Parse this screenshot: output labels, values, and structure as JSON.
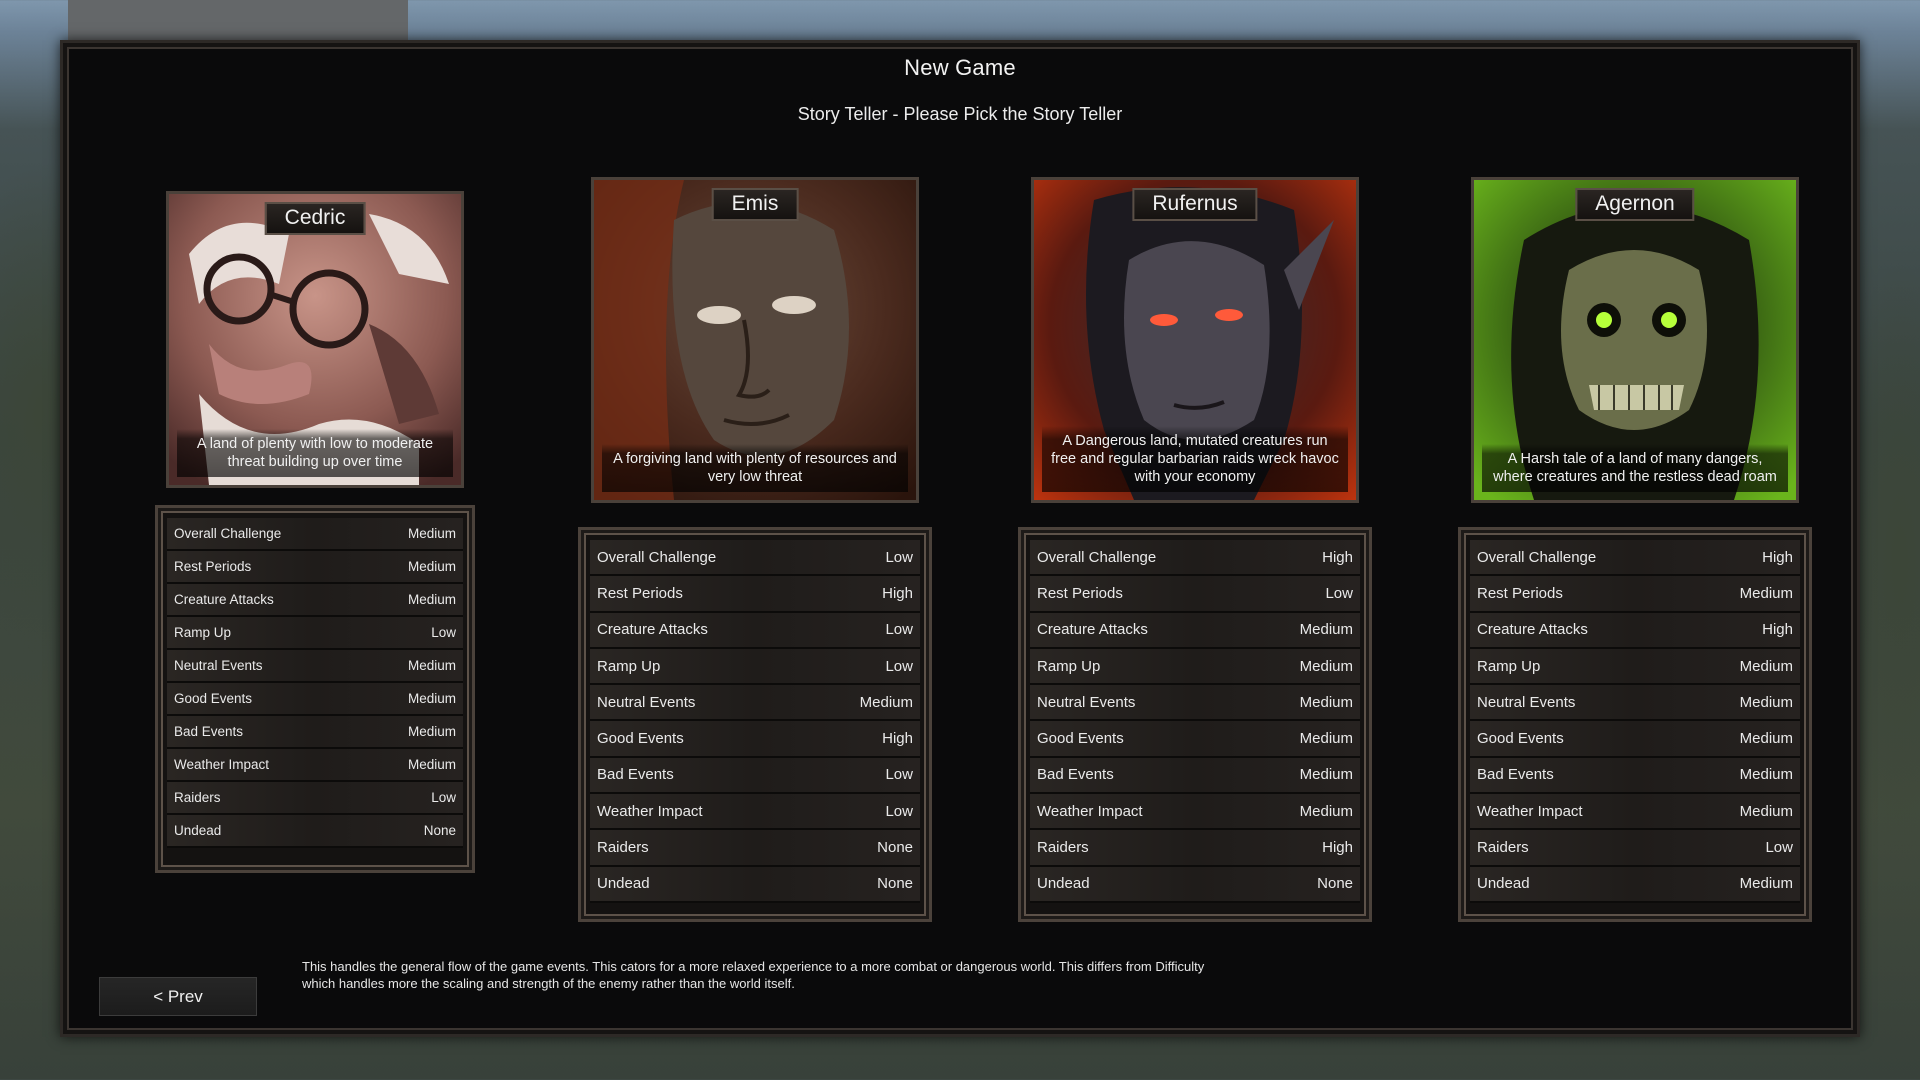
{
  "title": "New Game",
  "subtitle": "Story Teller - Please Pick the Story Teller",
  "storytellers": [
    {
      "name": "Cedric",
      "description": "A land of plenty with low to moderate threat building up over time",
      "stats": [
        {
          "label": "Overall Challenge",
          "value": "Medium"
        },
        {
          "label": "Rest Periods",
          "value": "Medium"
        },
        {
          "label": "Creature Attacks",
          "value": "Medium"
        },
        {
          "label": "Ramp Up",
          "value": "Low"
        },
        {
          "label": "Neutral Events",
          "value": "Medium"
        },
        {
          "label": "Good Events",
          "value": "Medium"
        },
        {
          "label": "Bad Events",
          "value": "Medium"
        },
        {
          "label": "Weather Impact",
          "value": "Medium"
        },
        {
          "label": "Raiders",
          "value": "Low"
        },
        {
          "label": "Undead",
          "value": "None"
        }
      ]
    },
    {
      "name": "Emis",
      "description": "A forgiving land with plenty of resources and very low threat",
      "stats": [
        {
          "label": "Overall Challenge",
          "value": "Low"
        },
        {
          "label": "Rest Periods",
          "value": "High"
        },
        {
          "label": "Creature Attacks",
          "value": "Low"
        },
        {
          "label": "Ramp Up",
          "value": "Low"
        },
        {
          "label": "Neutral Events",
          "value": "Medium"
        },
        {
          "label": "Good Events",
          "value": "High"
        },
        {
          "label": "Bad Events",
          "value": "Low"
        },
        {
          "label": "Weather Impact",
          "value": "Low"
        },
        {
          "label": "Raiders",
          "value": "None"
        },
        {
          "label": "Undead",
          "value": "None"
        }
      ]
    },
    {
      "name": "Rufernus",
      "description": "A Dangerous land, mutated creatures run free and regular barbarian raids wreck havoc with your economy",
      "stats": [
        {
          "label": "Overall Challenge",
          "value": "High"
        },
        {
          "label": "Rest Periods",
          "value": "Low"
        },
        {
          "label": "Creature Attacks",
          "value": "Medium"
        },
        {
          "label": "Ramp Up",
          "value": "Medium"
        },
        {
          "label": "Neutral Events",
          "value": "Medium"
        },
        {
          "label": "Good Events",
          "value": "Medium"
        },
        {
          "label": "Bad Events",
          "value": "Medium"
        },
        {
          "label": "Weather Impact",
          "value": "Medium"
        },
        {
          "label": "Raiders",
          "value": "High"
        },
        {
          "label": "Undead",
          "value": "None"
        }
      ]
    },
    {
      "name": "Agernon",
      "description": "A Harsh tale of a land of many dangers, where creatures and the restless dead roam",
      "stats": [
        {
          "label": "Overall Challenge",
          "value": "High"
        },
        {
          "label": "Rest Periods",
          "value": "Medium"
        },
        {
          "label": "Creature Attacks",
          "value": "High"
        },
        {
          "label": "Ramp Up",
          "value": "Medium"
        },
        {
          "label": "Neutral Events",
          "value": "Medium"
        },
        {
          "label": "Good Events",
          "value": "Medium"
        },
        {
          "label": "Bad Events",
          "value": "Medium"
        },
        {
          "label": "Weather Impact",
          "value": "Medium"
        },
        {
          "label": "Raiders",
          "value": "Low"
        },
        {
          "label": "Undead",
          "value": "Medium"
        }
      ]
    }
  ],
  "help_text_line1": "This handles the general flow of the game events. This cators for a more relaxed experience to a more combat or dangerous world. This differs from Difficulty",
  "help_text_line2": "which handles more the scaling and strength of the enemy rather than the world itself.",
  "prev_button": "< Prev"
}
